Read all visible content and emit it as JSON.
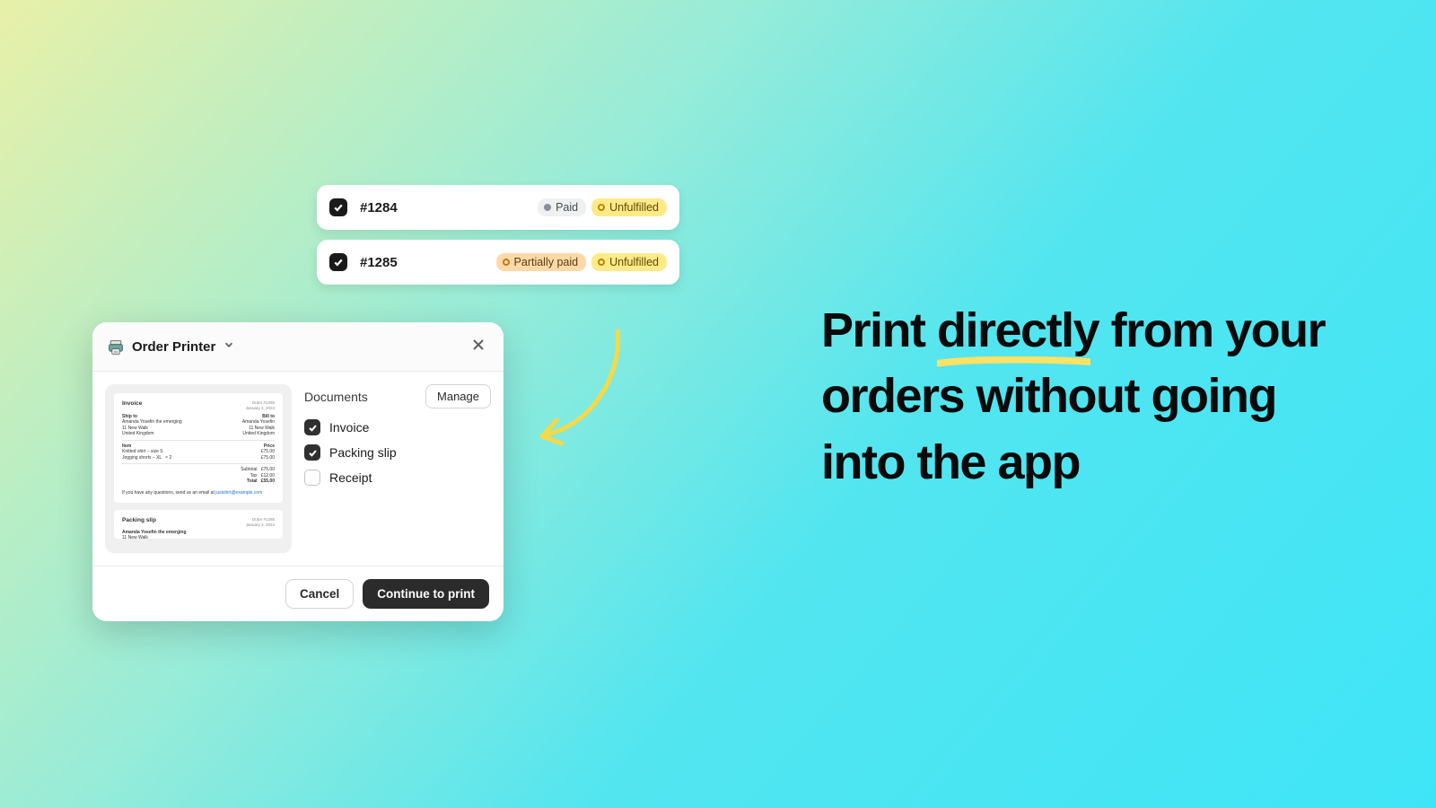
{
  "orders": [
    {
      "id": "#1284",
      "payment": {
        "label": "Paid",
        "variant": "paid"
      },
      "fulfillment": {
        "label": "Unfulfilled",
        "variant": "unfulfilled"
      },
      "checked": true
    },
    {
      "id": "#1285",
      "payment": {
        "label": "Partially paid",
        "variant": "partially-paid"
      },
      "fulfillment": {
        "label": "Unfulfilled",
        "variant": "unfulfilled"
      },
      "checked": true
    }
  ],
  "modal": {
    "title": "Order Printer",
    "documents_heading": "Documents",
    "manage_label": "Manage",
    "documents": [
      {
        "label": "Invoice",
        "checked": true
      },
      {
        "label": "Packing slip",
        "checked": true
      },
      {
        "label": "Receipt",
        "checked": false
      }
    ],
    "cancel_label": "Cancel",
    "continue_label": "Continue to print",
    "preview": {
      "invoice_title": "Invoice",
      "packing_title": "Packing slip"
    }
  },
  "headline": {
    "pre": "Print ",
    "highlight": "directly",
    "post": " from your orders without going into the app"
  },
  "colors": {
    "badge_paid_bg": "#eef0f2",
    "badge_partial_bg": "#fed9a8",
    "badge_unfulfilled_bg": "#ffea8a",
    "accent_underline": "#ffe164",
    "arrow": "#f5d948",
    "btn_primary_bg": "#2b2b2b"
  }
}
